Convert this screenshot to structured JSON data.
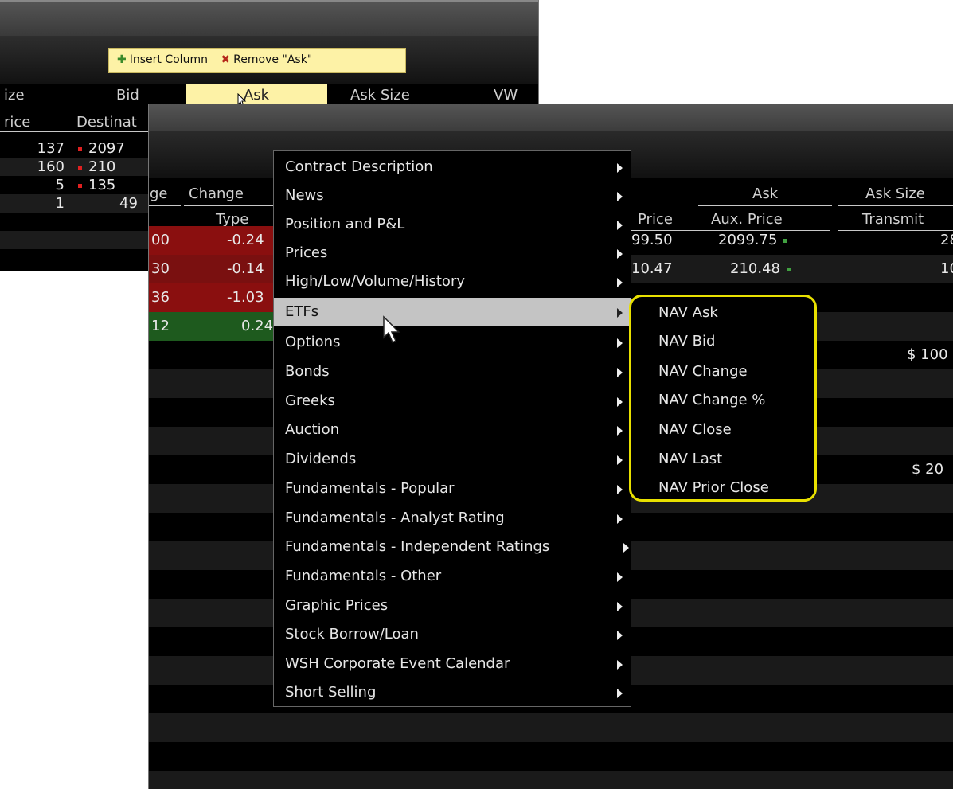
{
  "back_window": {
    "column_popup": {
      "insert_label": "Insert Column",
      "remove_label": "Remove \"Ask\""
    },
    "headers_row1": [
      "ize",
      "Bid",
      "Ask",
      "Ask Size",
      "VW"
    ],
    "headers_row2": [
      "rice",
      "Destinat"
    ],
    "rows": [
      {
        "size": "137",
        "bid": "2097"
      },
      {
        "size": "160",
        "bid": "210"
      },
      {
        "size": "5",
        "bid": "135"
      },
      {
        "size": "1",
        "bid": "49"
      }
    ]
  },
  "front_window": {
    "headers_row1": [
      "ge",
      "Change",
      "Ask",
      "Ask Size"
    ],
    "headers_row2": [
      "Type",
      "Price",
      "Aux. Price",
      "Transmit"
    ],
    "rows": [
      {
        "pct": "00",
        "chg": "-0.24",
        "price": "99.50",
        "aux": "2099.75",
        "size": "28"
      },
      {
        "pct": "30",
        "chg": "-0.14",
        "price": "10.47",
        "aux": "210.48",
        "size": "10"
      },
      {
        "pct": "36",
        "chg": "-1.03",
        "price": "",
        "aux": "",
        "size": ""
      },
      {
        "pct": "12",
        "chg": "0.24",
        "price": "",
        "aux": "",
        "size": ""
      }
    ],
    "amount1": "$ 100",
    "amount2": "$ 20"
  },
  "context_menu": {
    "items": [
      "Contract Description",
      "News",
      "Position and P&L",
      "Prices",
      "High/Low/Volume/History",
      "ETFs",
      "Options",
      "Bonds",
      "Greeks",
      "Auction",
      "Dividends",
      "Fundamentals - Popular",
      "Fundamentals - Analyst Rating",
      "Fundamentals - Independent Ratings",
      "Fundamentals - Other",
      "Graphic Prices",
      "Stock Borrow/Loan",
      "WSH Corporate Event Calendar",
      "Short Selling"
    ],
    "selected": "ETFs"
  },
  "submenu": {
    "items": [
      "NAV Ask",
      "NAV Bid",
      "NAV Change",
      "NAV Change %",
      "NAV Close",
      "NAV Last",
      "NAV Prior Close"
    ]
  },
  "colors": {
    "highlight_yellow": "#fdf2a6",
    "callout_yellow": "#e8e000",
    "row_red": "#8a0f0f",
    "row_green": "#1e5a1e",
    "selected_gray": "#c4c4c4"
  }
}
